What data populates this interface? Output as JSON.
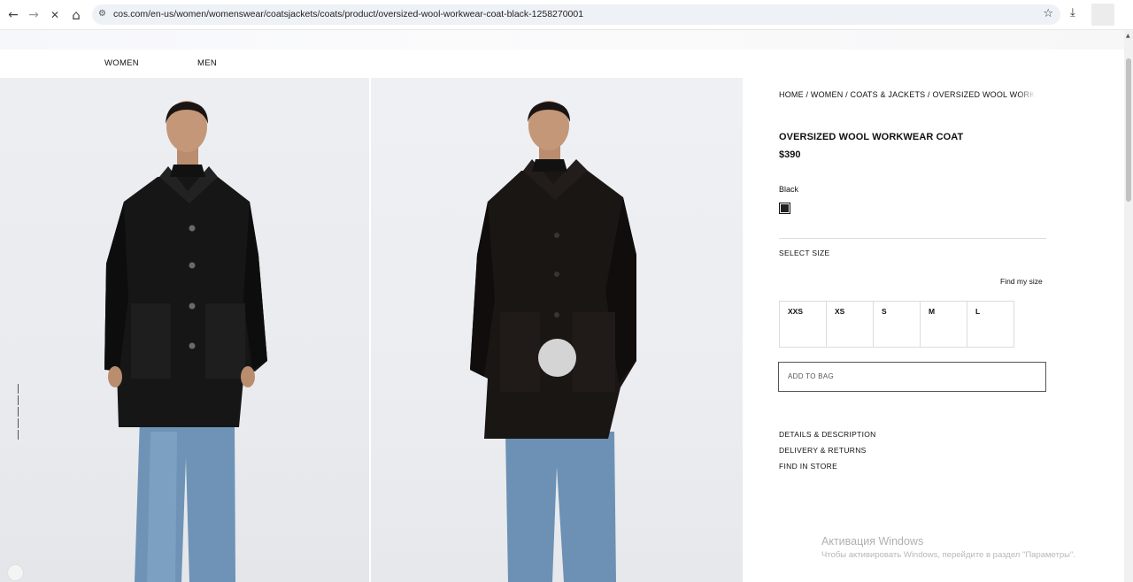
{
  "browser": {
    "url": "cos.com/en-us/women/womenswear/coatsjackets/coats/product/oversized-wool-workwear-coat-black-1258270001",
    "back_icon": "←",
    "forward_icon": "→",
    "stop_icon": "✕",
    "home_icon": "⌂",
    "site_settings_icon": "⚙",
    "bookmark_icon": "☆",
    "download_icon": "⤓"
  },
  "nav": {
    "women": "WOMEN",
    "men": "MEN"
  },
  "product": {
    "breadcrumb": "HOME / WOMEN / COATS & JACKETS / OVERSIZED WOOL WORKWEAR COAT",
    "title": "OVERSIZED WOOL WORKWEAR COAT",
    "price": "$390",
    "color": "Black",
    "swatch_color": "#222222",
    "select_size": "SELECT SIZE",
    "find_my_size": "Find my size",
    "sizes": [
      "XXS",
      "XS",
      "S",
      "M",
      "L"
    ],
    "add_to_bag": "ADD TO BAG",
    "accordion": [
      "DETAILS & DESCRIPTION",
      "DELIVERY & RETURNS",
      "FIND IN STORE"
    ]
  },
  "watermark": {
    "title": "Активация Windows",
    "subtitle": "Чтобы активировать Windows, перейдите в раздел \"Параметры\"."
  }
}
